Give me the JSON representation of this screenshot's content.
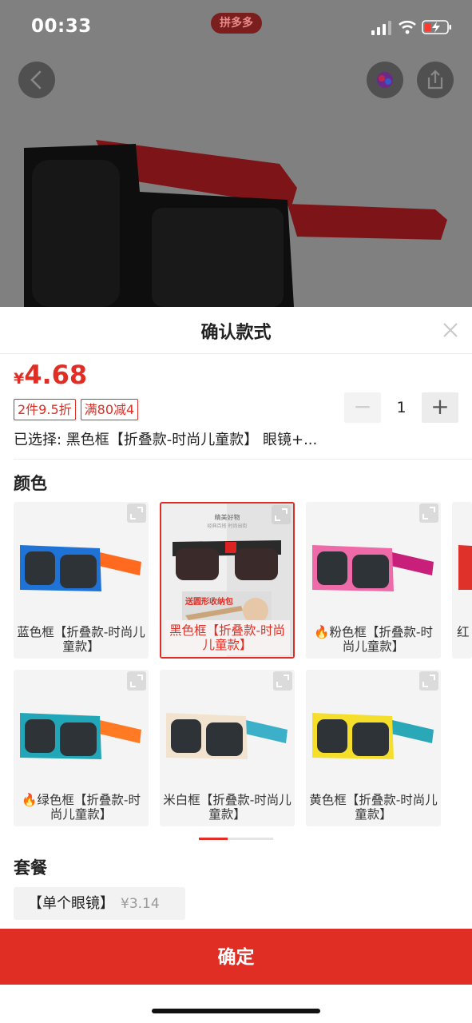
{
  "status_bar": {
    "time": "00:33",
    "app_badge": "拼多多"
  },
  "sheet": {
    "title": "确认款式"
  },
  "price": {
    "currency": "¥",
    "value": "4.68"
  },
  "tags": [
    "2件9.5折",
    "满80减4"
  ],
  "quantity": {
    "minus": "−",
    "value": "1",
    "plus": "+"
  },
  "selected_text": "已选择: 黑色框【折叠款-时尚儿童款】 眼镜+...",
  "color_section": {
    "title": "颜色",
    "options": [
      {
        "label": "蓝色框【折叠款-时尚儿童款】",
        "hot": false,
        "selected": false
      },
      {
        "label": "黑色框【折叠款-时尚儿童款】",
        "hot": false,
        "selected": true,
        "inner_texts": [
          "精美好物",
          "经典百搭 时尚出街",
          "送圆形收纳包"
        ]
      },
      {
        "label": "粉色框【折叠款-时尚儿童款】",
        "hot": true,
        "selected": false
      },
      {
        "label": "红",
        "hot": false,
        "selected": false
      },
      {
        "label": "绿色框【折叠款-时尚儿童款】",
        "hot": true,
        "selected": false
      },
      {
        "label": "米白框【折叠款-时尚儿童款】",
        "hot": false,
        "selected": false
      },
      {
        "label": "黄色框【折叠款-时尚儿童款】",
        "hot": false,
        "selected": false
      }
    ]
  },
  "package_section": {
    "title": "套餐",
    "options": [
      {
        "name": "【单个眼镜】",
        "price": "¥3.14"
      }
    ]
  },
  "confirm_label": "确定",
  "colors": {
    "accent": "#e02e24"
  },
  "icons": [
    "back-arrow-icon",
    "chat-icon",
    "share-icon",
    "close-icon",
    "expand-icon",
    "fire-icon"
  ]
}
